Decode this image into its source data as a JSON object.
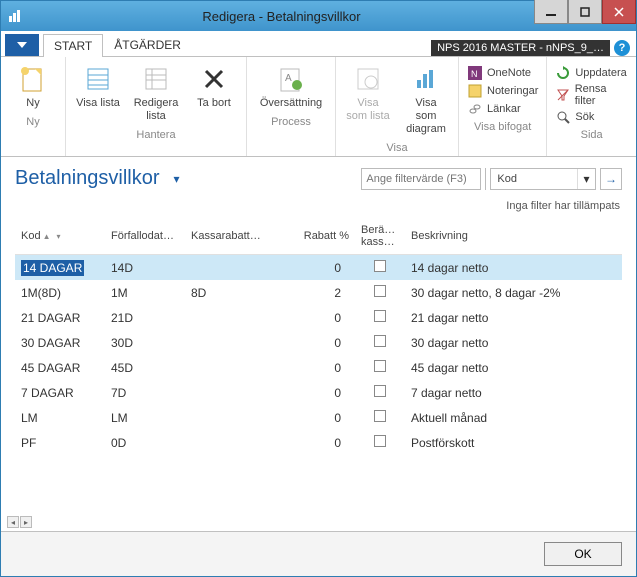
{
  "window": {
    "title": "Redigera - Betalningsvillkor"
  },
  "tabs": {
    "file_caret": "▼",
    "start": "START",
    "actions": "ÅTGÄRDER"
  },
  "badge": "NPS 2016 MASTER - nNPS_9_…",
  "ribbon": {
    "ny": {
      "label": "Ny",
      "group": "Ny"
    },
    "visa_lista": "Visa\nlista",
    "redigera_lista": "Redigera\nlista",
    "ta_bort": "Ta\nbort",
    "hantera_group": "Hantera",
    "oversattning": "Översättning",
    "process_group": "Process",
    "visa_som_lista": "Visa\nsom lista",
    "visa_som_diagram": "Visa som\ndiagram",
    "visa_group": "Visa",
    "onenote": "OneNote",
    "noteringar": "Noteringar",
    "lankar": "Länkar",
    "bifogat_group": "Visa bifogat",
    "uppdatera": "Uppdatera",
    "rensa_filter": "Rensa filter",
    "sok": "Sök",
    "sida_group": "Sida"
  },
  "page": {
    "title": "Betalningsvillkor",
    "filter_placeholder": "Ange filtervärde (F3)",
    "filter_field": "Kod",
    "filter_status": "Inga filter har tillämpats"
  },
  "columns": {
    "kod": "Kod",
    "forfallodat": "Förfallodat…",
    "kassarabatt": "Kassarabatt…",
    "rabatt": "Rabatt %",
    "berakn": "Berä…\nkass…",
    "beskrivning": "Beskrivning"
  },
  "rows": [
    {
      "kod": "14 DAGAR",
      "forf": "14D",
      "kass": "",
      "rabatt": "0",
      "besk": "14 dagar netto",
      "selected": true
    },
    {
      "kod": "1M(8D)",
      "forf": "1M",
      "kass": "8D",
      "rabatt": "2",
      "besk": "30 dagar netto, 8 dagar -2%"
    },
    {
      "kod": "21 DAGAR",
      "forf": "21D",
      "kass": "",
      "rabatt": "0",
      "besk": "21 dagar netto"
    },
    {
      "kod": "30 DAGAR",
      "forf": "30D",
      "kass": "",
      "rabatt": "0",
      "besk": "30 dagar netto"
    },
    {
      "kod": "45 DAGAR",
      "forf": "45D",
      "kass": "",
      "rabatt": "0",
      "besk": "45 dagar netto"
    },
    {
      "kod": "7 DAGAR",
      "forf": "7D",
      "kass": "",
      "rabatt": "0",
      "besk": "7 dagar netto"
    },
    {
      "kod": "LM",
      "forf": "LM",
      "kass": "",
      "rabatt": "0",
      "besk": "Aktuell månad"
    },
    {
      "kod": "PF",
      "forf": "0D",
      "kass": "",
      "rabatt": "0",
      "besk": "Postförskott"
    }
  ],
  "footer": {
    "ok": "OK"
  }
}
